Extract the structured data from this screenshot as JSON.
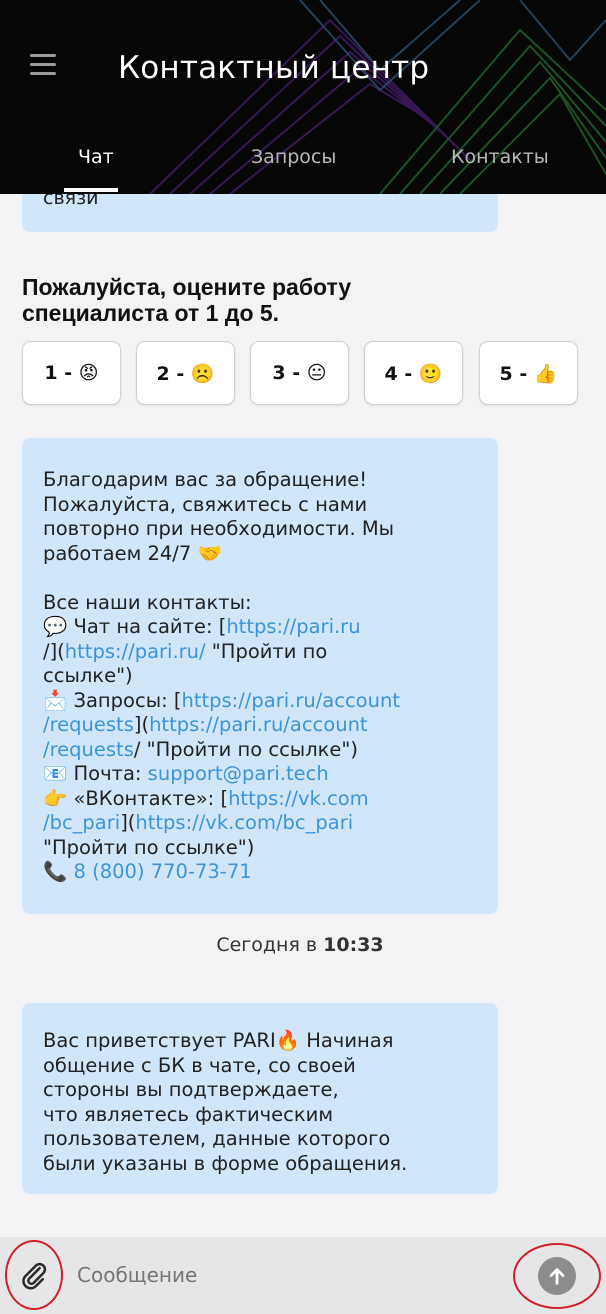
{
  "header": {
    "title": "Контактный центр",
    "tabs": [
      {
        "label": "Чат",
        "active": true
      },
      {
        "label": "Запросы",
        "active": false
      },
      {
        "label": "Контакты",
        "active": false
      }
    ]
  },
  "chat": {
    "prev_bubble_tail": "связи",
    "rating": {
      "title_line1": "Пожалуйста, оцените работу",
      "title_line2": "специалиста от 1 до 5.",
      "options": [
        "1 - 😡",
        "2 - ☹️",
        "3 - 😐",
        "4 - 🙂",
        "5 - 👍"
      ]
    },
    "thanks_message": {
      "l1": "Благодарим вас за обращение!",
      "l2": "Пожалуйста, свяжитесь с нами",
      "l3": "повторно при необходимости. Мы",
      "l4": "работаем 24/7 🤝",
      "contacts_title": "Все наши контакты:",
      "chat_prefix": "💬 Чат на сайте: [",
      "chat_url1a": "https://pari.ru",
      "chat_url1b": "/",
      "chat_mid": "](",
      "chat_url2": "https://pari.ru/",
      "chat_suffix1": " \"Пройти по",
      "chat_suffix2": "ссылке\")",
      "req_prefix": "📩 Запросы: [",
      "req_url1a": "https://pari.ru/account",
      "req_url1b": "/requests",
      "req_mid": "](",
      "req_url2a": "https://pari.ru/account",
      "req_url2b": "/requests",
      "req_suffix": "/ \"Пройти по ссылке\")",
      "mail_prefix": "📧 Почта: ",
      "mail": "support@pari.tech",
      "vk_prefix": "👉 «ВКонтакте»: [",
      "vk_url1a": "https://vk.com",
      "vk_url1b": "/bc_pari",
      "vk_mid": "](",
      "vk_url2": "https://vk.com/bc_pari",
      "vk_suffix": "\"Пройти по ссылке\")",
      "phone_prefix": "📞 ",
      "phone": "8 (800) 770-73-71"
    },
    "timestamp_prefix": "Сегодня в ",
    "timestamp_time": "10:33",
    "welcome_message": {
      "l1": "Вас приветствует PARI🔥 Начиная",
      "l2": "общение с БК в чате, со своей",
      "l3": "стороны вы подтверждаете,",
      "l4": "что являетесь фактическим",
      "l5": "пользователем, данные которого",
      "l6": "были указаны в форме обращения."
    }
  },
  "input": {
    "placeholder": "Сообщение"
  },
  "colors": {
    "header_bg": "#060606",
    "bubble_bg": "#d2e6f9",
    "link": "#3a95d8",
    "highlight_ring": "#d21f2b"
  },
  "icons": [
    "menu-icon",
    "paperclip-icon",
    "send-arrow-icon"
  ]
}
